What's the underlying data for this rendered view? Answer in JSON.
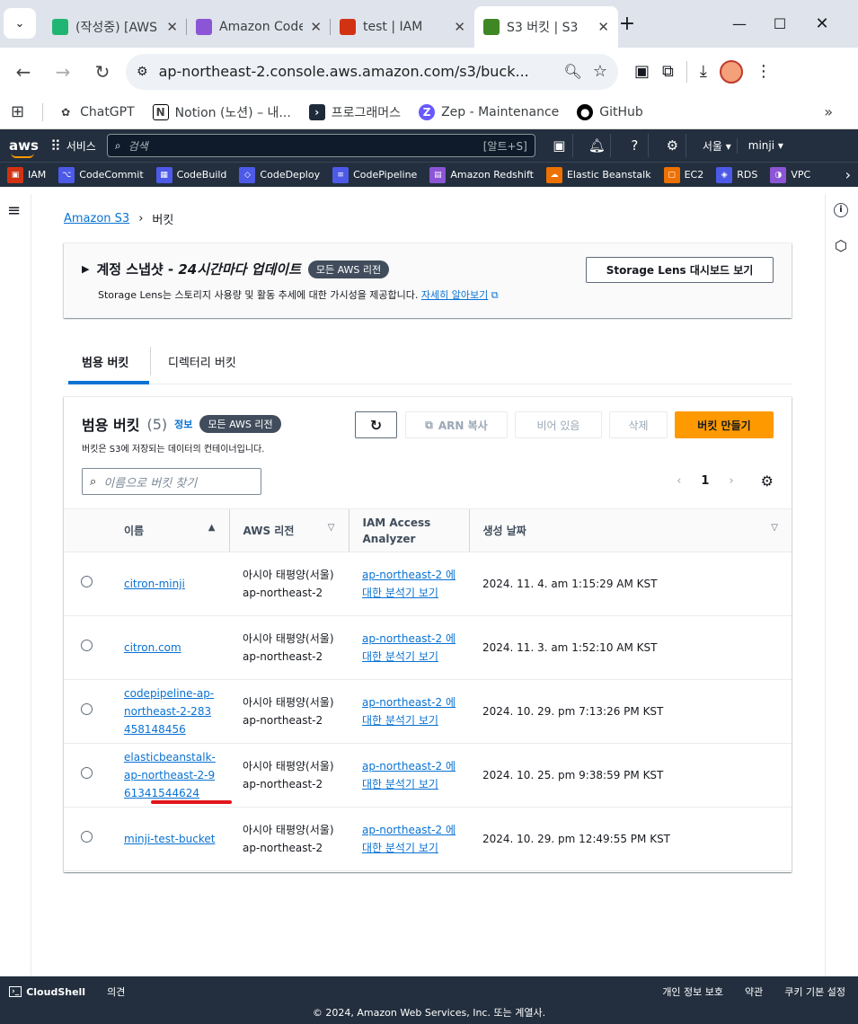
{
  "browser": {
    "tabs": [
      {
        "title": "(작성중) [AWS",
        "icon": "v-icon",
        "color": "#21b573"
      },
      {
        "title": "Amazon CodeDeploy",
        "icon": "deploy-icon",
        "color": "#8b55d6"
      },
      {
        "title": "test | IAM",
        "icon": "iam-icon",
        "color": "#d13212"
      },
      {
        "title": "S3 버킷 | S3",
        "icon": "s3-icon",
        "color": "#3f8624"
      }
    ],
    "url": "ap-northeast-2.console.aws.amazon.com/s3/buck...",
    "bookmarks": [
      "ChatGPT",
      "Notion (노션) – 내...",
      "프로그래머스",
      "Zep - Maintenance",
      "GitHub"
    ]
  },
  "awsnav": {
    "logo": "aws",
    "services": "서비스",
    "search_placeholder": "검색",
    "shortcut": "[알트+S]",
    "region": "서울 ▾",
    "user": "minji ▾"
  },
  "favorites": [
    {
      "label": "IAM",
      "color": "#d13212",
      "glyph": "▣"
    },
    {
      "label": "CodeCommit",
      "color": "#4d5ae8",
      "glyph": "⌥"
    },
    {
      "label": "CodeBuild",
      "color": "#4d5ae8",
      "glyph": "▦"
    },
    {
      "label": "CodeDeploy",
      "color": "#4d5ae8",
      "glyph": "◇"
    },
    {
      "label": "CodePipeline",
      "color": "#4d5ae8",
      "glyph": "≡"
    },
    {
      "label": "Amazon Redshift",
      "color": "#8b55d6",
      "glyph": "▤"
    },
    {
      "label": "Elastic Beanstalk",
      "color": "#ed7100",
      "glyph": "☁"
    },
    {
      "label": "EC2",
      "color": "#ed7100",
      "glyph": "▢"
    },
    {
      "label": "RDS",
      "color": "#4d5ae8",
      "glyph": "◈"
    },
    {
      "label": "VPC",
      "color": "#8b55d6",
      "glyph": "◑"
    }
  ],
  "breadcrumb": {
    "root": "Amazon S3",
    "current": "버킷"
  },
  "snapshot": {
    "title_a": "계정 스냅샷 - ",
    "title_b": "24시간마다 업데이트",
    "badge": "모든 AWS 리전",
    "desc": "Storage Lens는 스토리지 사용량 및 활동 추세에 대한 가시성을 제공합니다.",
    "learn": "자세히 알아보기",
    "button": "Storage Lens 대시보드 보기"
  },
  "tabs": [
    {
      "label": "범용 버킷"
    },
    {
      "label": "디렉터리 버킷"
    }
  ],
  "buckets": {
    "title": "범용 버킷",
    "count": "(5)",
    "info": "정보",
    "badge": "모든 AWS 리전",
    "subtitle": "버킷은 S3에 저장되는 데이터의 컨테이너입니다.",
    "search_placeholder": "이름으로 버킷 찾기",
    "actions": {
      "copy_arn": "ARN 복사",
      "empty": "비어 있음",
      "delete": "삭제",
      "create": "버킷 만들기"
    },
    "page": "1",
    "columns": {
      "name": "이름",
      "region": "AWS 리전",
      "iam1": "IAM Access",
      "iam2": "Analyzer",
      "created": "생성 날짜"
    },
    "rows": [
      {
        "name": "citron-minji",
        "region": "아시아 태평양(서울) ap-northeast-2",
        "analyzer": "ap-northeast-2 에 대한 분석기 보기",
        "created": "2024. 11. 4. am 1:15:29 AM KST"
      },
      {
        "name": "citron.com",
        "region": "아시아 태평양(서울) ap-northeast-2",
        "analyzer": "ap-northeast-2 에 대한 분석기 보기",
        "created": "2024. 11. 3. am 1:52:10 AM KST"
      },
      {
        "name": "codepipeline-ap-northeast-2-283458148456",
        "region": "아시아 태평양(서울) ap-northeast-2",
        "analyzer": "ap-northeast-2 에 대한 분석기 보기",
        "created": "2024. 10. 29. pm 7:13:26 PM KST"
      },
      {
        "name": "elasticbeanstalk-ap-northeast-2-961341544624",
        "region": "아시아 태평양(서울) ap-northeast-2",
        "analyzer": "ap-northeast-2 에 대한 분석기 보기",
        "created": "2024. 10. 25. pm 9:38:59 PM KST"
      },
      {
        "name": "minji-test-bucket",
        "region": "아시아 태평양(서울) ap-northeast-2",
        "analyzer": "ap-northeast-2 에 대한 분석기 보기",
        "created": "2024. 10. 29. pm 12:49:55 PM KST"
      }
    ]
  },
  "footer": {
    "cloudshell": "CloudShell",
    "feedback": "의견",
    "privacy": "개인 정보 보호",
    "terms": "약관",
    "cookies": "쿠키 기본 설정",
    "copyright": "© 2024, Amazon Web Services, Inc. 또는 계열사."
  }
}
